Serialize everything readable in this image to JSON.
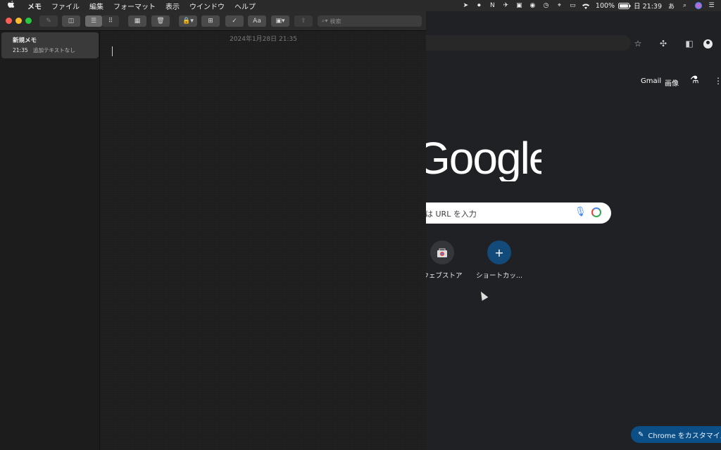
{
  "menubar": {
    "apple": "",
    "menus": [
      "メモ",
      "ファイル",
      "編集",
      "フォーマット",
      "表示",
      "ウインドウ",
      "ヘルプ"
    ],
    "battery": "100%",
    "clock": "日 21:39",
    "input_method": "あ"
  },
  "notes": {
    "search_placeholder": "検索",
    "note": {
      "title": "新規メモ",
      "time": "21:35",
      "preview": "追加テキストなし"
    },
    "editor_date": "2024年1月28日 21:35",
    "font_button": "Aa"
  },
  "chrome": {
    "links": {
      "gmail": "Gmail",
      "images": "画像"
    },
    "logo": "Google",
    "search_placeholder": "は URL を入力",
    "shortcuts": [
      {
        "label": "ウェブストア"
      },
      {
        "label": "ショートカッ..."
      }
    ],
    "customize_label": "Chrome をカスタマイズ",
    "colors": {
      "background": "#202124",
      "accent": "#0b4f86",
      "add_tile": "#124a7a"
    }
  }
}
